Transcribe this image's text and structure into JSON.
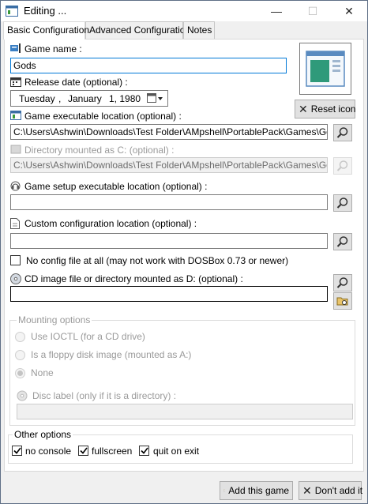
{
  "window": {
    "title": "Editing ...",
    "controls": {
      "minimize": "—",
      "maximize": "☐",
      "close": "✕"
    }
  },
  "tabs": [
    {
      "label": "Basic Configuration",
      "active": true
    },
    {
      "label": "Advanced Configuration",
      "active": false
    },
    {
      "label": "Notes",
      "active": false
    }
  ],
  "game_name": {
    "label": "Game name :",
    "value": "Gods"
  },
  "release_date": {
    "label": "Release date (optional) :",
    "weekday": "Tuesday",
    "sep": ",",
    "month": "January",
    "day": "1, 1980"
  },
  "reset_icon_label": "Reset icon",
  "game_exe": {
    "label": "Game executable location (optional) :",
    "value": "C:\\Users\\Ashwin\\Downloads\\Test Folder\\AMpshell\\PortablePack\\Games\\Gods\\Go"
  },
  "mounted_c": {
    "label": "Directory mounted as C: (optional) :",
    "value": "C:\\Users\\Ashwin\\Downloads\\Test Folder\\AMpshell\\PortablePack\\Games\\Gods"
  },
  "setup_exe": {
    "label": "Game setup executable location (optional) :",
    "value": ""
  },
  "custom_config": {
    "label": "Custom configuration location (optional) :",
    "value": ""
  },
  "no_config": {
    "label": "No config file at all (may not work with DOSBox 0.73 or newer)",
    "checked": false
  },
  "cd_image": {
    "label": "CD image file or directory mounted as D: (optional) :",
    "value": ""
  },
  "mounting": {
    "title": "Mounting options",
    "options": [
      "Use IOCTL (for a CD drive)",
      "Is a floppy disk image (mounted as A:)",
      "None"
    ],
    "selected": "None",
    "disc_label": "Disc label (only if it is a directory) :",
    "disc_value": ""
  },
  "other": {
    "title": "Other options",
    "checks": [
      {
        "label": "no console",
        "checked": true
      },
      {
        "label": "fullscreen",
        "checked": true
      },
      {
        "label": "quit on exit",
        "checked": true
      }
    ]
  },
  "buttons": {
    "add": "Add this game",
    "cancel": "Don't add it"
  },
  "colors": {
    "accent_border": "#0078d7",
    "window_bg": "#f0f0f0",
    "panel_bg": "#ffffff"
  }
}
